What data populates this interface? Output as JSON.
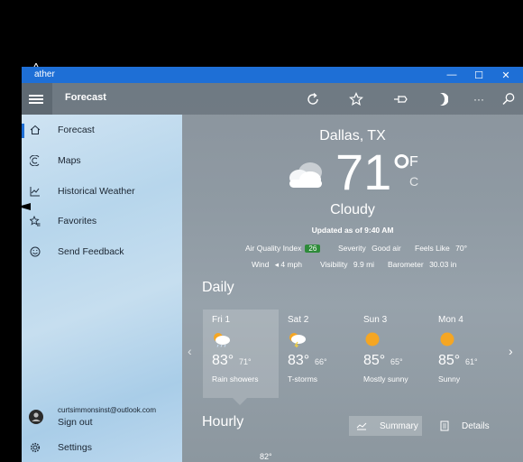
{
  "window": {
    "title": "ather",
    "minimize": "—",
    "maximize": "☐",
    "close": "✕"
  },
  "topbar": {
    "title": "Forecast",
    "icons": [
      "refresh-icon",
      "star-icon",
      "pin-icon",
      "moon-icon",
      "more-icon",
      "search-icon"
    ],
    "more": "···"
  },
  "sidebar": {
    "items": [
      {
        "label": "Forecast",
        "icon": "home-icon",
        "selected": true
      },
      {
        "label": "Maps",
        "icon": "maps-icon"
      },
      {
        "label": "Historical Weather",
        "icon": "chart-icon"
      },
      {
        "label": "Favorites",
        "icon": "favorites-icon"
      },
      {
        "label": "Send Feedback",
        "icon": "smiley-icon"
      }
    ],
    "account": {
      "email": "curtsimmonsinst@outlook.com",
      "signout": "Sign out"
    },
    "settings": "Settings"
  },
  "current": {
    "city": "Dallas, TX",
    "temp": "71°",
    "unit_f": "F",
    "unit_c": "C",
    "condition": "Cloudy",
    "updated": "Updated as of 9:40 AM",
    "aqi_label": "Air Quality Index",
    "aqi_value": "26",
    "severity_label": "Severity",
    "severity_value": "Good air",
    "feels_label": "Feels Like",
    "feels_value": "70°",
    "wind_label": "Wind",
    "wind_value": "◂ 4 mph",
    "visibility_label": "Visibility",
    "visibility_value": "9.9 mi",
    "barometer_label": "Barometer",
    "barometer_value": "30.03 in"
  },
  "daily": {
    "title": "Daily",
    "days": [
      {
        "name": "Fri 1",
        "hi": "83°",
        "lo": "71°",
        "desc": "Rain showers",
        "icon": "rain-icon"
      },
      {
        "name": "Sat 2",
        "hi": "83°",
        "lo": "66°",
        "desc": "T-storms",
        "icon": "storm-icon"
      },
      {
        "name": "Sun 3",
        "hi": "85°",
        "lo": "65°",
        "desc": "Mostly sunny",
        "icon": "sun-icon"
      },
      {
        "name": "Mon 4",
        "hi": "85°",
        "lo": "61°",
        "desc": "Sunny",
        "icon": "sun-icon"
      }
    ],
    "prev": "‹",
    "next": "›"
  },
  "hourly": {
    "title": "Hourly",
    "summary": "Summary",
    "details": "Details",
    "first_temp": "82°"
  },
  "colors": {
    "accent": "#1e6fd6",
    "aqi_good": "#2e8b3a",
    "sun": "#f5a623"
  }
}
